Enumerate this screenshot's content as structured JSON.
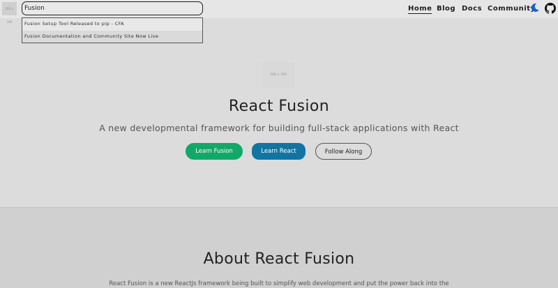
{
  "header": {
    "logo_text": "100 × 100",
    "search": {
      "value": "Fusion"
    },
    "nav": [
      "Home",
      "Blog",
      "Docs",
      "Community"
    ],
    "active_nav": "Home"
  },
  "search_results": [
    "Fusion Setup Tool Released to pip - CFA",
    "Fusion Documentation and Community Site Now Live"
  ],
  "hero": {
    "image_text": "100 × 100",
    "title": "React Fusion",
    "subtitle": "A new developmental framework for building full-stack applications with React",
    "buttons": {
      "learn_fusion": "Learn Fusion",
      "learn_react": "Learn React",
      "follow_along": "Follow Along"
    }
  },
  "about": {
    "title": "About React Fusion",
    "text": "React Fusion is a new ReactJs framework being built to simplify web development and put the power back into the"
  },
  "colors": {
    "green": "#12a868",
    "blue": "#1175a3",
    "moon": "#1a5fd0"
  },
  "icons": [
    "moon-icon",
    "github-icon"
  ]
}
